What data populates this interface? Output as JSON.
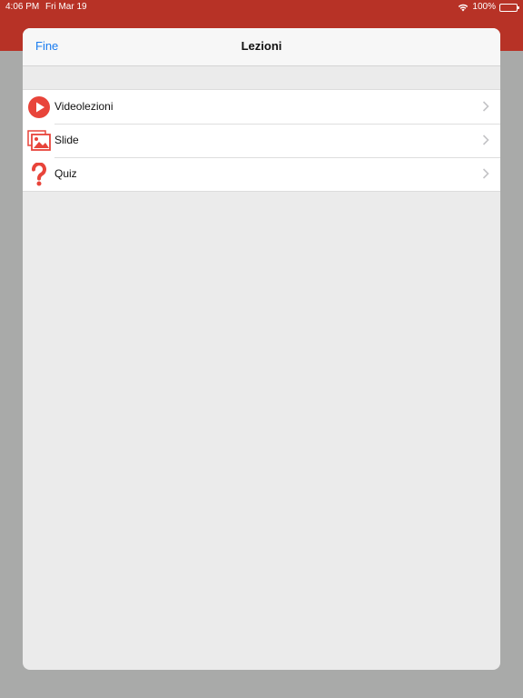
{
  "status_bar": {
    "time": "4:06 PM",
    "date": "Fri Mar 19",
    "battery": "100%",
    "battery_level": 1.0
  },
  "sheet": {
    "done_label": "Fine",
    "title": "Lezioni",
    "items": [
      {
        "label": "Videolezioni",
        "icon": "play-circle-icon"
      },
      {
        "label": "Slide",
        "icon": "image-gallery-icon"
      },
      {
        "label": "Quiz",
        "icon": "question-mark-icon"
      }
    ]
  },
  "colors": {
    "accent": "#1a7cf0",
    "header_red": "#b73226",
    "icon_red": "#e8443a"
  }
}
